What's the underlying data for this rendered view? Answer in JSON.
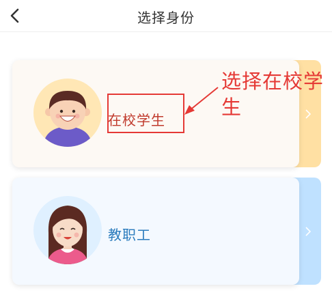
{
  "header": {
    "title": "选择身份",
    "back_icon": "chevron-left-icon"
  },
  "cards": [
    {
      "label": "在校学生",
      "accent": "#ffe0a3",
      "label_color": "#c0392b",
      "avatar": "boy-avatar-icon"
    },
    {
      "label": "教职工",
      "accent": "#bfe1ff",
      "label_color": "#2a7bbd",
      "avatar": "girl-avatar-icon"
    }
  ],
  "annotation": {
    "text": "选择在校学生",
    "color": "#e53935"
  }
}
